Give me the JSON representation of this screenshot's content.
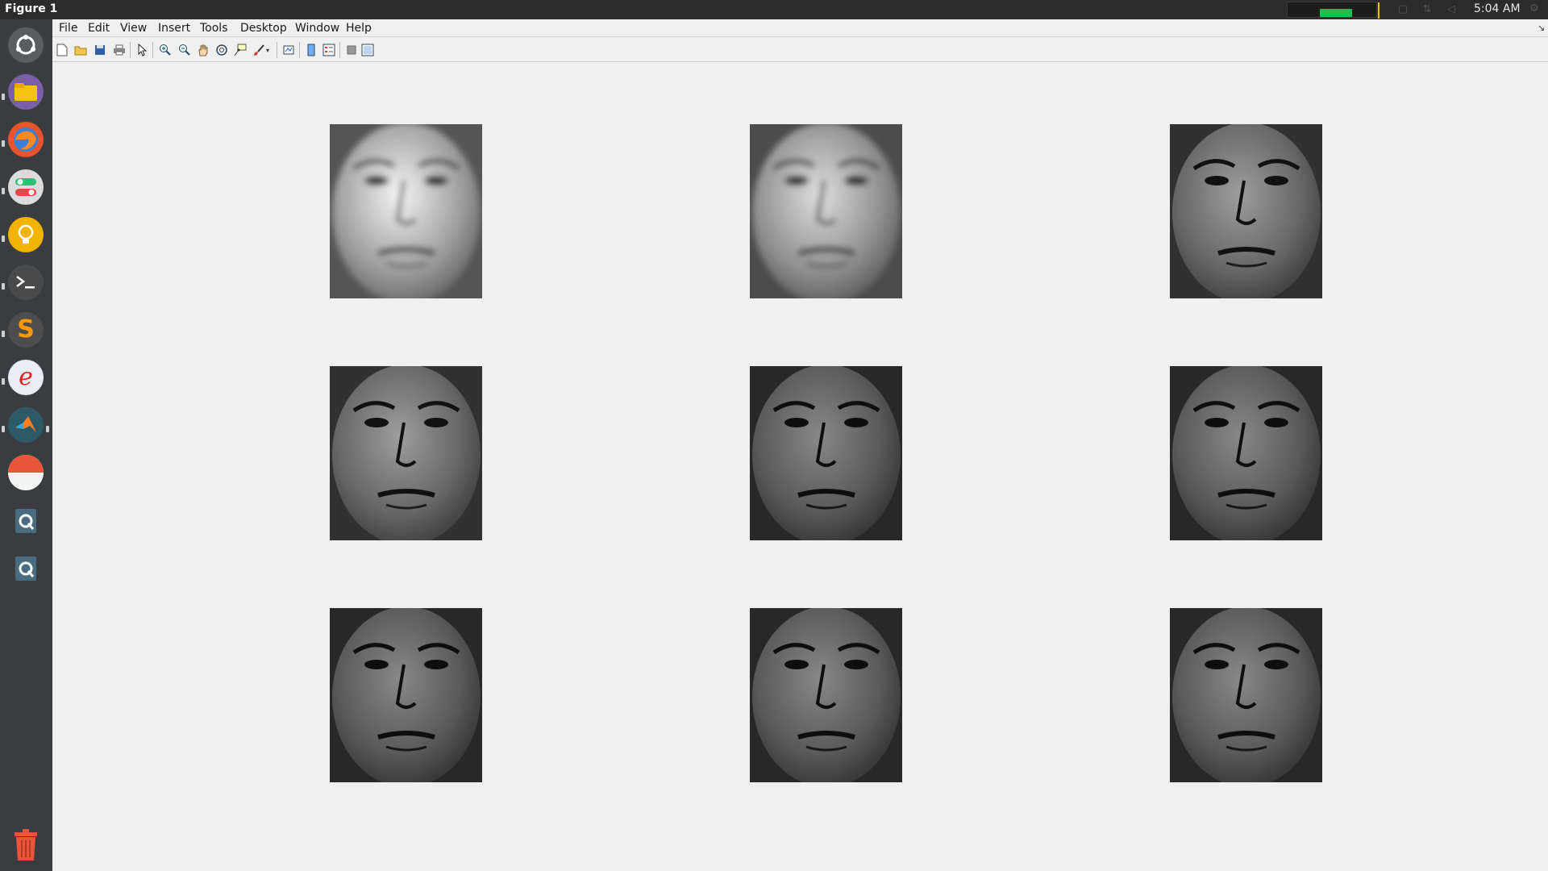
{
  "window": {
    "title": "Figure 1"
  },
  "panel": {
    "clock": "5:04 AM"
  },
  "menu": [
    "File",
    "Edit",
    "View",
    "Insert",
    "Tools",
    "Desktop",
    "Window",
    "Help"
  ],
  "launcher": [
    "ubuntu-dash",
    "files",
    "firefox",
    "settings-toggle",
    "idea-bulb",
    "terminal",
    "sublime-text",
    "text-editor",
    "matlab",
    "pie-app",
    "q-app-1",
    "q-app-2",
    "trash"
  ],
  "toolbar": [
    "new-figure",
    "open-file",
    "save",
    "print",
    "edit-plot",
    "zoom-in",
    "zoom-out",
    "pan",
    "rotate-3d",
    "data-cursor",
    "brush",
    "link-plot",
    "insert-colorbar",
    "insert-legend",
    "hide-plot-tools",
    "show-plot-tools"
  ],
  "faces": {
    "rows": 3,
    "cols": 3,
    "brightness": [
      [
        0.95,
        0.85,
        0.55
      ],
      [
        0.55,
        0.45,
        0.45
      ],
      [
        0.45,
        0.45,
        0.45
      ]
    ],
    "blur": [
      [
        true,
        true,
        false
      ],
      [
        false,
        false,
        false
      ],
      [
        false,
        false,
        false
      ]
    ]
  },
  "colors": {
    "panel_bg": "#2b2b2b",
    "launcher_bg": "#3a3d40",
    "figure_bg": "#f0f0f0",
    "monitor_green": "#1fbf4a"
  }
}
